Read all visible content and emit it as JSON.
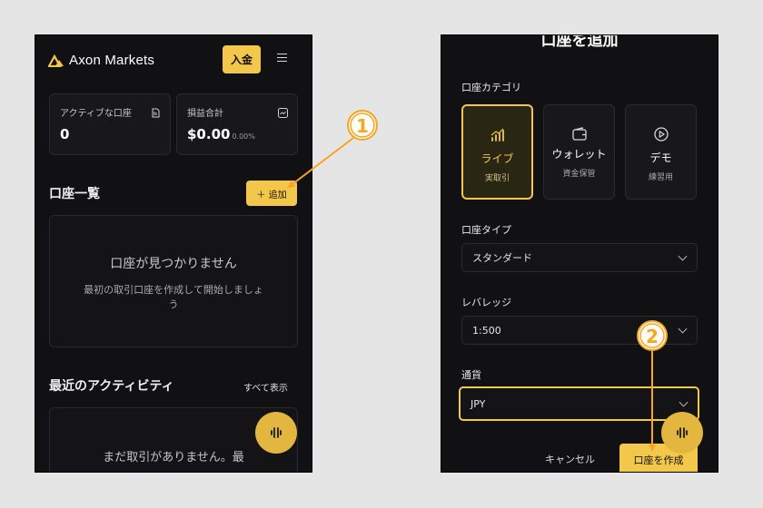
{
  "left": {
    "brand": "Axon Markets",
    "deposit_label": "入金",
    "stats": [
      {
        "label": "アクティブな口座",
        "value": "0",
        "sub": ""
      },
      {
        "label": "損益合計",
        "value": "$0.00",
        "sub": "0.00%"
      }
    ],
    "accounts_title": "口座一覧",
    "add_label": "＋ 追加",
    "empty_title": "口座が見つかりません",
    "empty_desc": "最初の取引口座を作成して開始しましょう",
    "activity_title": "最近のアクティビティ",
    "see_all": "すべて表示",
    "no_trades": "まだ取引がありません。最"
  },
  "right": {
    "modal_title": "口座を追加",
    "category_label": "口座カテゴリ",
    "categories": [
      {
        "title": "ライブ",
        "sub": "実取引",
        "icon": "chart-bars-icon",
        "active": true
      },
      {
        "title": "ウォレット",
        "sub": "資金保管",
        "icon": "wallet-icon",
        "active": false
      },
      {
        "title": "デモ",
        "sub": "練習用",
        "icon": "play-circle-icon",
        "active": false
      }
    ],
    "type_label": "口座タイプ",
    "type_value": "スタンダード",
    "leverage_label": "レバレッジ",
    "leverage_value": "1:500",
    "currency_label": "通貨",
    "currency_value": "JPY",
    "cancel_label": "キャンセル",
    "create_label": "口座を作成"
  },
  "annotations": {
    "marker_1": "1",
    "marker_2": "2"
  },
  "colors": {
    "accent": "#f3c84a",
    "marker": "#f5a623",
    "background": "#111113"
  }
}
